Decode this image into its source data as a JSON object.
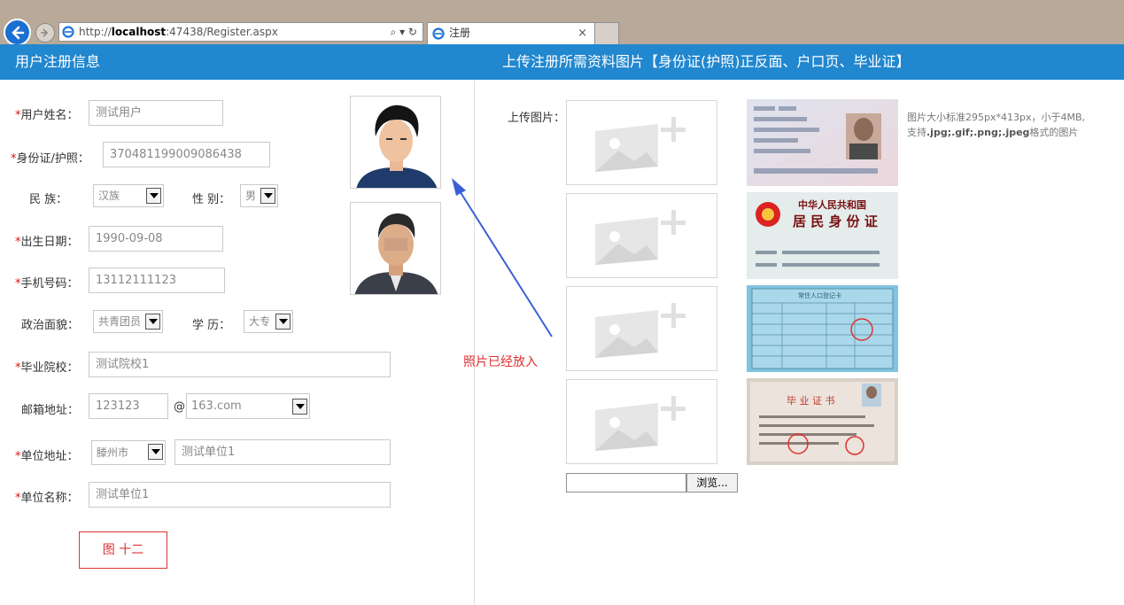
{
  "browser": {
    "url_prefix": "http://",
    "url_host": "localhost",
    "url_rest": ":47438/Register.aspx",
    "url_tools": "⌕ ▾ ↻",
    "tab_title": "注册",
    "tab_close": "×"
  },
  "header": {
    "left_title": "用户注册信息",
    "right_title": "上传注册所需资料图片【身份证(护照)正反面、户口页、毕业证】"
  },
  "form": {
    "required_mark": "*",
    "name_label": "用户姓名：",
    "name_value": "测试用户",
    "id_label": "身份证/护照：",
    "id_value": "370481199009086438",
    "ethnic_label": "民 族：",
    "ethnic_value": "汉族",
    "gender_label": "性 别：",
    "gender_value": "男",
    "birth_label": "出生日期：",
    "birth_value": "1990-09-08",
    "phone_label": "手机号码：",
    "phone_value": "13112111123",
    "politics_label": "政治面貌：",
    "politics_value": "共青团员",
    "edu_label": "学 历：",
    "edu_value": "大专",
    "school_label": "毕业院校：",
    "school_value": "测试院校1",
    "email_label": "邮箱地址：",
    "email_user": "123123",
    "email_at": "@",
    "email_domain": "163.com",
    "unit_addr_label": "单位地址：",
    "unit_city": "滕州市",
    "unit_addr_value": "测试单位1",
    "unit_name_label": "单位名称：",
    "unit_name_value": "测试单位1",
    "figure_button": "图 十二"
  },
  "annotation": {
    "note": "照片已经放入",
    "arrow_color": "#3b5fd6"
  },
  "upload": {
    "label": "上传图片：",
    "hint_line1": "图片大小标准295px*413px，小于4MB,",
    "hint_pre": "支持",
    "hint_formats": ".jpg;.gif;.png;.jpeg",
    "hint_post": "格式的图片",
    "browse_button": "浏览..."
  },
  "documents": {
    "id_back_title1": "中华人民共和国",
    "id_back_title2": "居 民 身 份 证",
    "hukou_title": "常住人口登记卡",
    "diploma_title": "毕 业 证 书"
  },
  "colors": {
    "header_bg": "#2187cf",
    "required": "#dd1111",
    "note": "#e03030"
  }
}
